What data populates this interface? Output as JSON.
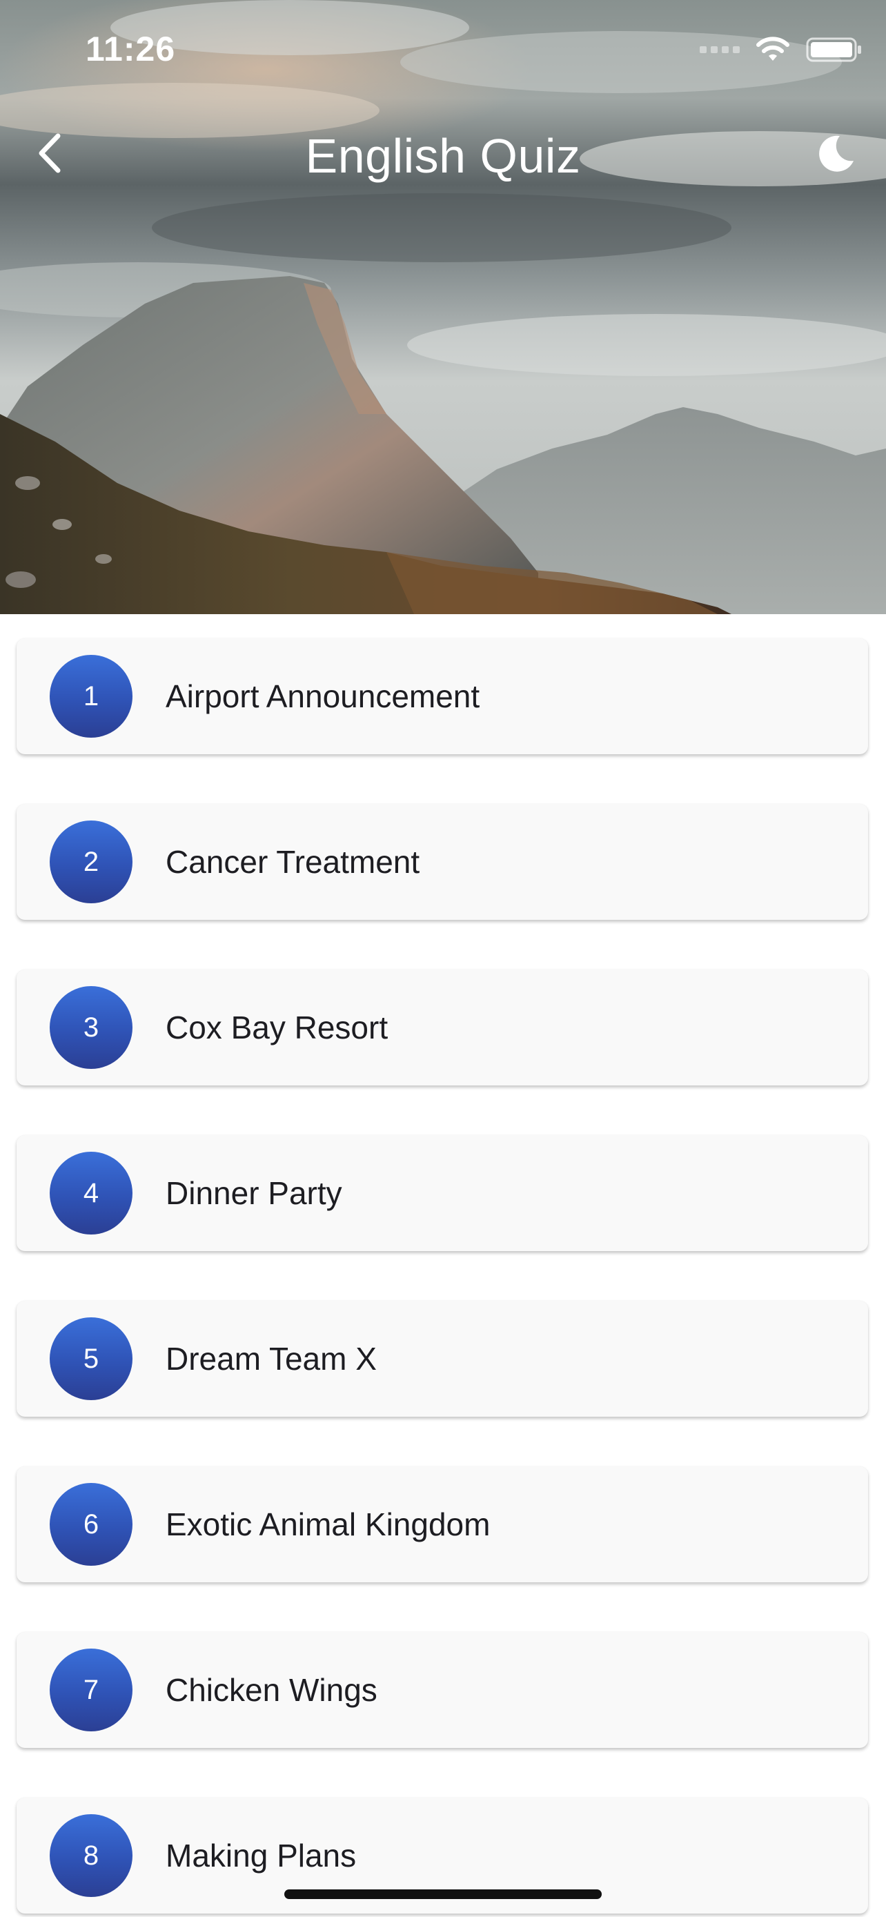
{
  "status_bar": {
    "time": "11:26"
  },
  "nav": {
    "title": "English Quiz",
    "back_icon": "chevron-left-icon",
    "theme_icon": "moon-icon"
  },
  "colors": {
    "badge_gradient_top": "#3a6fd9",
    "badge_gradient_bottom": "#2b3f94",
    "card_background": "#f9f9f9",
    "text": "#1d1d22"
  },
  "quizzes": [
    {
      "number": "1",
      "title": "Airport Announcement"
    },
    {
      "number": "2",
      "title": "Cancer Treatment"
    },
    {
      "number": "3",
      "title": "Cox Bay Resort"
    },
    {
      "number": "4",
      "title": "Dinner Party"
    },
    {
      "number": "5",
      "title": "Dream Team X"
    },
    {
      "number": "6",
      "title": "Exotic Animal Kingdom"
    },
    {
      "number": "7",
      "title": "Chicken Wings"
    },
    {
      "number": "8",
      "title": "Making Plans"
    }
  ]
}
